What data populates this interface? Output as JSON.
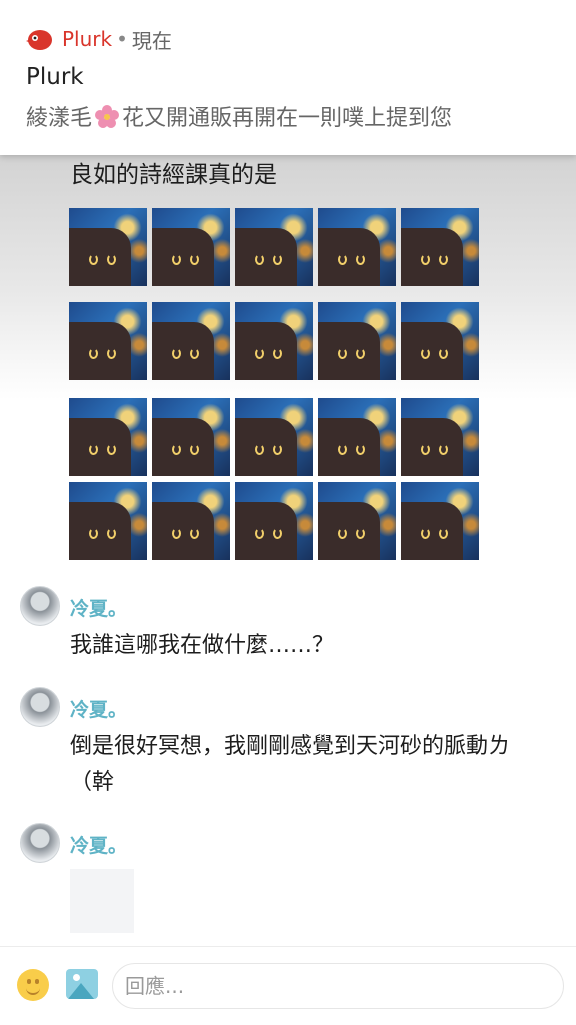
{
  "notification": {
    "app_name": "Plurk",
    "separator": "•",
    "time": "現在",
    "title": "Plurk",
    "body_before": "綾漾毛",
    "body_after": "花又開通販再開在一則噗上提到您"
  },
  "post": {
    "text": "良如的詩經課真的是",
    "stickers": {
      "rows": 4,
      "cols": 5
    }
  },
  "comments": [
    {
      "name": "冷夏。",
      "text": "我誰這哪我在做什麼……？"
    },
    {
      "name": "冷夏。",
      "text": "倒是很好冥想，我剛剛感覺到天河砂的脈動ㄌ（幹"
    },
    {
      "name": "冷夏。",
      "text": ""
    }
  ],
  "bottom_bar": {
    "reply_placeholder": "回應..."
  },
  "colors": {
    "brand": "#d9352b",
    "username": "#5fb3c6"
  }
}
